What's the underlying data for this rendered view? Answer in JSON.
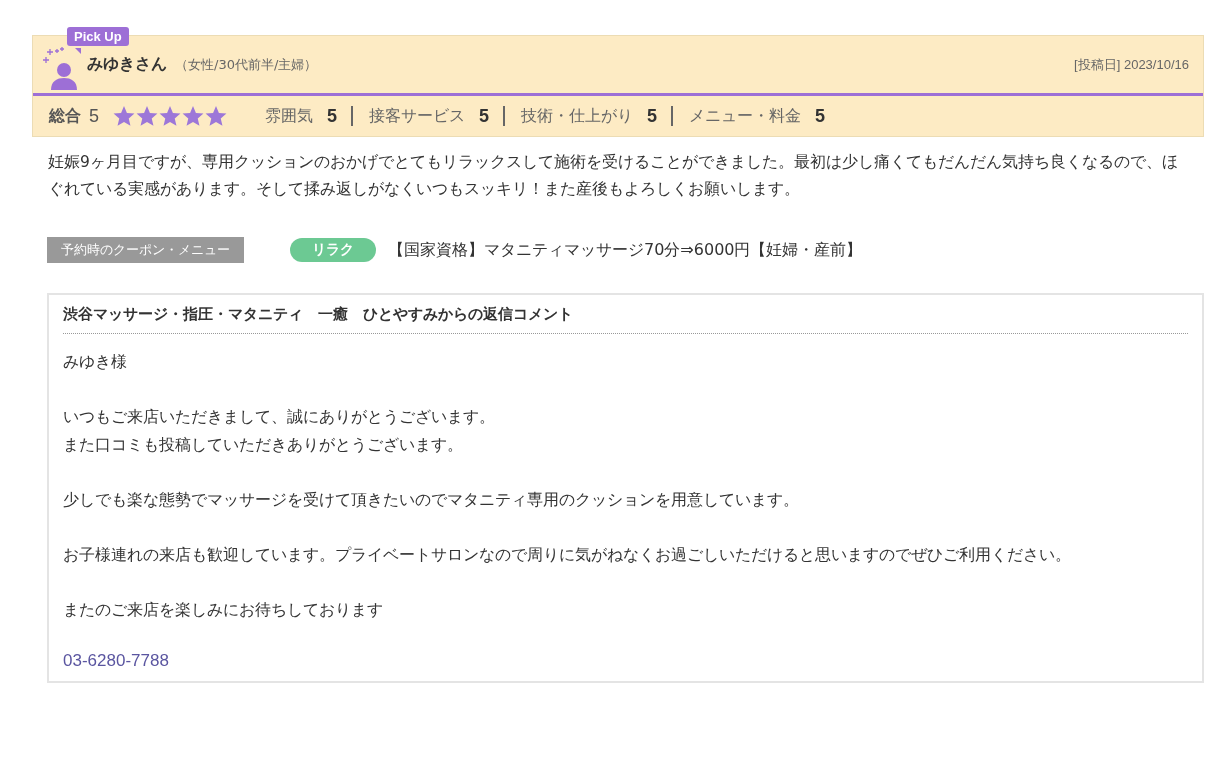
{
  "review": {
    "badge": "Pick Up",
    "name": "みゆきさん",
    "profile": "（女性/30代前半/主婦）",
    "posted": "[投稿日] 2023/10/16",
    "overall_label": "総合",
    "overall_score": "5",
    "stars": 5,
    "ratings": [
      {
        "label": "雰囲気",
        "score": "5"
      },
      {
        "label": "接客サービス",
        "score": "5"
      },
      {
        "label": "技術・仕上がり",
        "score": "5"
      },
      {
        "label": "メニュー・料金",
        "score": "5"
      }
    ],
    "body": "妊娠9ヶ月目ですが、専用クッションのおかげでとてもリラックスして施術を受けることができました。最初は少し痛くてもだんだん気持ち良くなるので、ほぐれている実感があります。そして揉み返しがなくいつもスッキリ！また産後もよろしくお願いします。",
    "coupon": {
      "label": "予約時のクーポン・メニュー",
      "tag": "リラク",
      "title": "【国家資格】マタニティマッサージ70分⇒6000円【妊婦・産前】"
    }
  },
  "reply": {
    "title": "渋谷マッサージ・指圧・マタニティ　一癒　ひとやすみからの返信コメント",
    "paragraphs": [
      [
        "みゆき様"
      ],
      [
        "いつもご来店いただきまして、誠にありがとうございます。",
        "また口コミも投稿していただきありがとうございます。"
      ],
      [
        "少しでも楽な態勢でマッサージを受けて頂きたいのでマタニティ専用のクッションを用意しています。"
      ],
      [
        "お子様連れの来店も歓迎しています。プライベートサロンなので周りに気がねなくお過ごしいただけると思いますのでぜひご利用ください。"
      ],
      [
        "またのご来店を楽しみにお待ちしております"
      ]
    ],
    "phone": "03-6280-7788"
  }
}
